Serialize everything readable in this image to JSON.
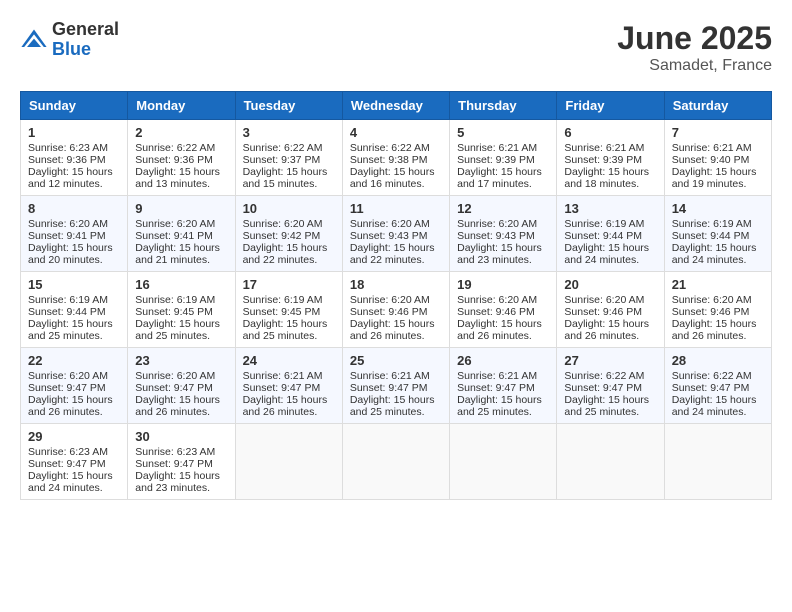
{
  "header": {
    "logo_general": "General",
    "logo_blue": "Blue",
    "month": "June 2025",
    "location": "Samadet, France"
  },
  "days_of_week": [
    "Sunday",
    "Monday",
    "Tuesday",
    "Wednesday",
    "Thursday",
    "Friday",
    "Saturday"
  ],
  "weeks": [
    [
      {
        "day": 1,
        "sunrise": "Sunrise: 6:23 AM",
        "sunset": "Sunset: 9:36 PM",
        "daylight": "Daylight: 15 hours and 12 minutes."
      },
      {
        "day": 2,
        "sunrise": "Sunrise: 6:22 AM",
        "sunset": "Sunset: 9:36 PM",
        "daylight": "Daylight: 15 hours and 13 minutes."
      },
      {
        "day": 3,
        "sunrise": "Sunrise: 6:22 AM",
        "sunset": "Sunset: 9:37 PM",
        "daylight": "Daylight: 15 hours and 15 minutes."
      },
      {
        "day": 4,
        "sunrise": "Sunrise: 6:22 AM",
        "sunset": "Sunset: 9:38 PM",
        "daylight": "Daylight: 15 hours and 16 minutes."
      },
      {
        "day": 5,
        "sunrise": "Sunrise: 6:21 AM",
        "sunset": "Sunset: 9:39 PM",
        "daylight": "Daylight: 15 hours and 17 minutes."
      },
      {
        "day": 6,
        "sunrise": "Sunrise: 6:21 AM",
        "sunset": "Sunset: 9:39 PM",
        "daylight": "Daylight: 15 hours and 18 minutes."
      },
      {
        "day": 7,
        "sunrise": "Sunrise: 6:21 AM",
        "sunset": "Sunset: 9:40 PM",
        "daylight": "Daylight: 15 hours and 19 minutes."
      }
    ],
    [
      {
        "day": 8,
        "sunrise": "Sunrise: 6:20 AM",
        "sunset": "Sunset: 9:41 PM",
        "daylight": "Daylight: 15 hours and 20 minutes."
      },
      {
        "day": 9,
        "sunrise": "Sunrise: 6:20 AM",
        "sunset": "Sunset: 9:41 PM",
        "daylight": "Daylight: 15 hours and 21 minutes."
      },
      {
        "day": 10,
        "sunrise": "Sunrise: 6:20 AM",
        "sunset": "Sunset: 9:42 PM",
        "daylight": "Daylight: 15 hours and 22 minutes."
      },
      {
        "day": 11,
        "sunrise": "Sunrise: 6:20 AM",
        "sunset": "Sunset: 9:43 PM",
        "daylight": "Daylight: 15 hours and 22 minutes."
      },
      {
        "day": 12,
        "sunrise": "Sunrise: 6:20 AM",
        "sunset": "Sunset: 9:43 PM",
        "daylight": "Daylight: 15 hours and 23 minutes."
      },
      {
        "day": 13,
        "sunrise": "Sunrise: 6:19 AM",
        "sunset": "Sunset: 9:44 PM",
        "daylight": "Daylight: 15 hours and 24 minutes."
      },
      {
        "day": 14,
        "sunrise": "Sunrise: 6:19 AM",
        "sunset": "Sunset: 9:44 PM",
        "daylight": "Daylight: 15 hours and 24 minutes."
      }
    ],
    [
      {
        "day": 15,
        "sunrise": "Sunrise: 6:19 AM",
        "sunset": "Sunset: 9:44 PM",
        "daylight": "Daylight: 15 hours and 25 minutes."
      },
      {
        "day": 16,
        "sunrise": "Sunrise: 6:19 AM",
        "sunset": "Sunset: 9:45 PM",
        "daylight": "Daylight: 15 hours and 25 minutes."
      },
      {
        "day": 17,
        "sunrise": "Sunrise: 6:19 AM",
        "sunset": "Sunset: 9:45 PM",
        "daylight": "Daylight: 15 hours and 25 minutes."
      },
      {
        "day": 18,
        "sunrise": "Sunrise: 6:20 AM",
        "sunset": "Sunset: 9:46 PM",
        "daylight": "Daylight: 15 hours and 26 minutes."
      },
      {
        "day": 19,
        "sunrise": "Sunrise: 6:20 AM",
        "sunset": "Sunset: 9:46 PM",
        "daylight": "Daylight: 15 hours and 26 minutes."
      },
      {
        "day": 20,
        "sunrise": "Sunrise: 6:20 AM",
        "sunset": "Sunset: 9:46 PM",
        "daylight": "Daylight: 15 hours and 26 minutes."
      },
      {
        "day": 21,
        "sunrise": "Sunrise: 6:20 AM",
        "sunset": "Sunset: 9:46 PM",
        "daylight": "Daylight: 15 hours and 26 minutes."
      }
    ],
    [
      {
        "day": 22,
        "sunrise": "Sunrise: 6:20 AM",
        "sunset": "Sunset: 9:47 PM",
        "daylight": "Daylight: 15 hours and 26 minutes."
      },
      {
        "day": 23,
        "sunrise": "Sunrise: 6:20 AM",
        "sunset": "Sunset: 9:47 PM",
        "daylight": "Daylight: 15 hours and 26 minutes."
      },
      {
        "day": 24,
        "sunrise": "Sunrise: 6:21 AM",
        "sunset": "Sunset: 9:47 PM",
        "daylight": "Daylight: 15 hours and 26 minutes."
      },
      {
        "day": 25,
        "sunrise": "Sunrise: 6:21 AM",
        "sunset": "Sunset: 9:47 PM",
        "daylight": "Daylight: 15 hours and 25 minutes."
      },
      {
        "day": 26,
        "sunrise": "Sunrise: 6:21 AM",
        "sunset": "Sunset: 9:47 PM",
        "daylight": "Daylight: 15 hours and 25 minutes."
      },
      {
        "day": 27,
        "sunrise": "Sunrise: 6:22 AM",
        "sunset": "Sunset: 9:47 PM",
        "daylight": "Daylight: 15 hours and 25 minutes."
      },
      {
        "day": 28,
        "sunrise": "Sunrise: 6:22 AM",
        "sunset": "Sunset: 9:47 PM",
        "daylight": "Daylight: 15 hours and 24 minutes."
      }
    ],
    [
      {
        "day": 29,
        "sunrise": "Sunrise: 6:23 AM",
        "sunset": "Sunset: 9:47 PM",
        "daylight": "Daylight: 15 hours and 24 minutes."
      },
      {
        "day": 30,
        "sunrise": "Sunrise: 6:23 AM",
        "sunset": "Sunset: 9:47 PM",
        "daylight": "Daylight: 15 hours and 23 minutes."
      },
      null,
      null,
      null,
      null,
      null
    ]
  ]
}
